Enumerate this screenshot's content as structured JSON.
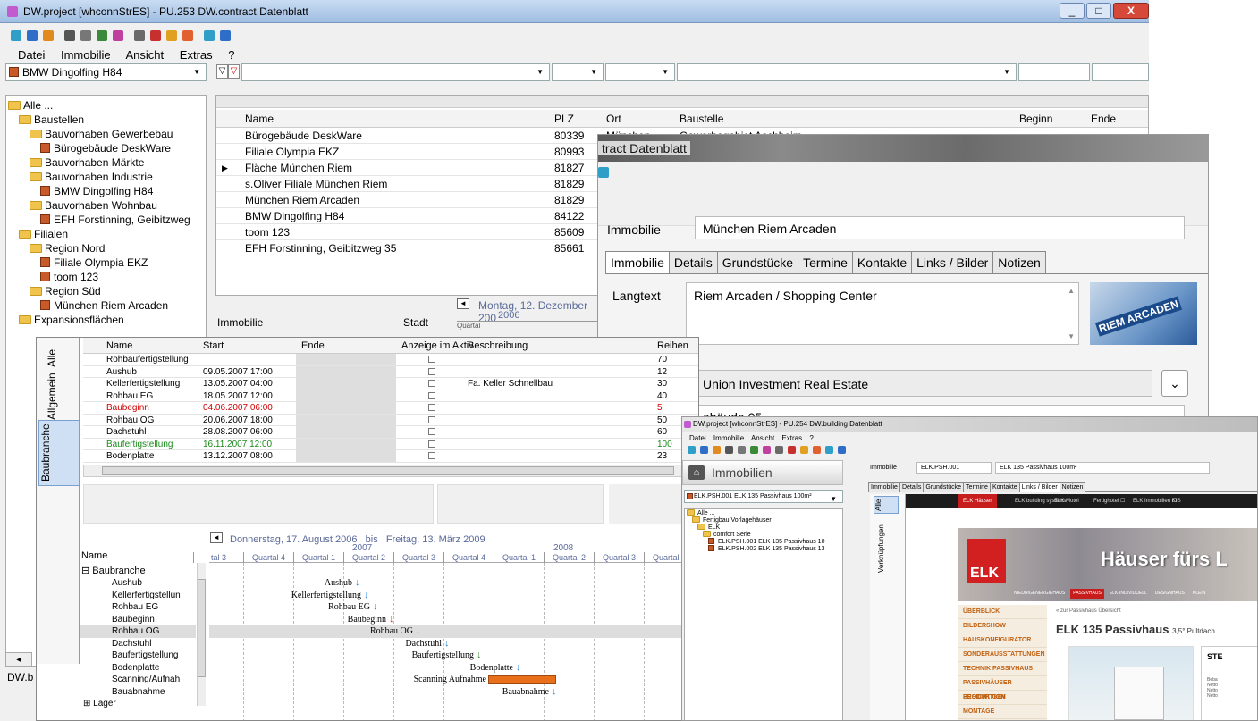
{
  "main": {
    "title": "DW.project [whconnStrES] - PU.253 DW.contract Datenblatt",
    "menu": [
      "Datei",
      "Immobilie",
      "Ansicht",
      "Extras",
      "?"
    ],
    "filter_combo": "BMW Dingolfing H84",
    "tree": [
      {
        "label": "Alle ...",
        "indent": 0,
        "folder": true
      },
      {
        "label": "Baustellen",
        "indent": 1,
        "folder": true
      },
      {
        "label": "Bauvorhaben Gewerbebau",
        "indent": 2,
        "folder": true
      },
      {
        "label": "Bürogebäude DeskWare",
        "indent": 3,
        "folder": false
      },
      {
        "label": "Bauvorhaben Märkte",
        "indent": 2,
        "folder": true
      },
      {
        "label": "Bauvorhaben Industrie",
        "indent": 2,
        "folder": true
      },
      {
        "label": "BMW Dingolfing H84",
        "indent": 3,
        "folder": false
      },
      {
        "label": "Bauvorhaben Wohnbau",
        "indent": 2,
        "folder": true
      },
      {
        "label": "EFH Forstinning, Geibitzweg",
        "indent": 3,
        "folder": false
      },
      {
        "label": "Filialen",
        "indent": 1,
        "folder": true
      },
      {
        "label": "Region Nord",
        "indent": 2,
        "folder": true
      },
      {
        "label": "Filiale Olympia EKZ",
        "indent": 3,
        "folder": false
      },
      {
        "label": "toom 123",
        "indent": 3,
        "folder": false
      },
      {
        "label": "Region Süd",
        "indent": 2,
        "folder": true
      },
      {
        "label": "München Riem Arcaden",
        "indent": 3,
        "folder": false
      },
      {
        "label": "Expansionsflächen",
        "indent": 1,
        "folder": true
      }
    ],
    "grid": {
      "headers": [
        "Name",
        "PLZ",
        "Ort",
        "Baustelle",
        "Beginn",
        "Ende"
      ],
      "rows": [
        [
          "Bürogebäude DeskWare",
          "80339",
          "München",
          "Gewerbegebiet Aschheim"
        ],
        [
          "Filiale Olympia EKZ",
          "80993"
        ],
        [
          "Fläche München Riem",
          "81827"
        ],
        [
          "s.Oliver Filiale München Riem",
          "81829"
        ],
        [
          "München Riem Arcaden",
          "81829"
        ],
        [
          "BMW Dingolfing H84",
          "84122"
        ],
        [
          "toom 123",
          "85609"
        ],
        [
          "EFH Forstinning, Geibitzweg 35",
          "85661"
        ]
      ]
    },
    "lower_labels": {
      "immobilie": "Immobilie",
      "stadt": "Stadt",
      "date": "Montag, 12. Dezember 200",
      "year": "2006",
      "quartal": "Quartal"
    },
    "status": "DW.b"
  },
  "contract": {
    "title": "tract Datenblatt",
    "immobilie_label": "Immobilie",
    "immobilie_value": "München Riem Arcaden",
    "tabs": [
      "Immobilie",
      "Details",
      "Grundstücke",
      "Termine",
      "Kontakte",
      "Links / Bilder",
      "Notizen"
    ],
    "langtext_label": "Langtext",
    "langtext_value": "Riem Arcaden / Shopping Center",
    "owner": "Union Investment Real Estate",
    "gebaeude": "ebäude 05",
    "logo_text": "RIEM ARCADEN"
  },
  "tasks": {
    "vtabs": [
      "Alle",
      "Allgemein",
      "Baubranche"
    ],
    "headers": [
      "Name",
      "Start",
      "Ende",
      "Anzeige im Aktiv",
      "Beschreibung",
      "Reihen"
    ],
    "rows": [
      {
        "name": "Rohbaufertigstellung",
        "start": "",
        "desc": "",
        "reihe": "70",
        "color": "#000"
      },
      {
        "name": "Aushub",
        "start": "09.05.2007 17:00",
        "desc": "",
        "reihe": "12",
        "color": "#000"
      },
      {
        "name": "Kellerfertigstellung",
        "start": "13.05.2007 04:00",
        "desc": "Fa. Keller Schnellbau",
        "reihe": "30",
        "color": "#000"
      },
      {
        "name": "Rohbau EG",
        "start": "18.05.2007 12:00",
        "desc": "",
        "reihe": "40",
        "color": "#000"
      },
      {
        "name": "Baubeginn",
        "start": "04.06.2007 06:00",
        "desc": "",
        "reihe": "5",
        "color": "#d00000"
      },
      {
        "name": "Rohbau OG",
        "start": "20.06.2007 18:00",
        "desc": "",
        "reihe": "50",
        "color": "#000"
      },
      {
        "name": "Dachstuhl",
        "start": "28.08.2007 06:00",
        "desc": "",
        "reihe": "60",
        "color": "#000"
      },
      {
        "name": "Baufertigstellung",
        "start": "16.11.2007 12:00",
        "desc": "",
        "reihe": "100",
        "color": "#1a8a1a"
      },
      {
        "name": "Bodenplatte",
        "start": "13.12.2007 08:00",
        "desc": "",
        "reihe": "23",
        "color": "#000"
      }
    ],
    "gantt_range": "Donnerstag, 17. August 2006   bis   Freitag, 13. März 2009",
    "gantt_years": [
      "2007",
      "2008"
    ],
    "gantt_quarters": [
      "tal 3",
      "Quartal 4",
      "Quartal 1",
      "Quartal 2",
      "Quartal 3",
      "Quartal 4",
      "Quartal 1",
      "Quartal 2",
      "Quartal 3",
      "Quartal 4"
    ],
    "gantt_name_header": "Name",
    "gantt_group": "Baubranche",
    "gantt_names": [
      "Aushub",
      "Kellerfertigstellun",
      "Rohbau EG",
      "Baubeginn",
      "Rohbau OG",
      "Dachstuhl",
      "Baufertigstellung",
      "Bodenplatte",
      "Scanning/Aufnah",
      "Bauabnahme",
      "Lager"
    ],
    "gantt_marks": [
      "Aushub",
      "Kellerfertigstellung",
      "Rohbau EG",
      "Baubeginn",
      "Rohbau OG",
      "Dachstuhl",
      "Baufertigstellung",
      "Bodenplatte",
      "Scanning Aufnahme",
      "Bauabnahme"
    ]
  },
  "building": {
    "title": "DW.project [whconnStrES] - PU.254 DW.building Datenblatt",
    "menu": [
      "Datei",
      "Immobilie",
      "Ansicht",
      "Extras",
      "?"
    ],
    "header": "Immobilien",
    "combo": "ELK.PSH.001 ELK 135 Passivhaus 100m²",
    "tree": [
      {
        "label": "Alle ...",
        "indent": 0,
        "folder": true
      },
      {
        "label": "Fertigbau Vorlagehäuser",
        "indent": 1,
        "folder": true
      },
      {
        "label": "ELK",
        "indent": 2,
        "folder": true
      },
      {
        "label": "comfort Serie",
        "indent": 3,
        "folder": true
      },
      {
        "label": "ELK.PSH.001 ELK 135 Passivhaus 10",
        "indent": 4,
        "folder": false
      },
      {
        "label": "ELK.PSH.002 ELK 135 Passivhaus 13",
        "indent": 4,
        "folder": false
      }
    ],
    "immobilie_label": "Immobilie",
    "code": "ELK.PSH.001",
    "name": "ELK 135 Passivhaus 100m²",
    "tabs": [
      "Immobilie",
      "Details",
      "Grundstücke",
      "Termine",
      "Kontakte",
      "Links / Bilder",
      "Notizen"
    ],
    "vtabs": [
      "Alle",
      "Verknüpfungen"
    ],
    "web_nav": [
      "ELK Häuser",
      "ELK building systems",
      "ELK Motel",
      "Fertighotel ☐",
      "ELK Immobilien ☐",
      "KIS"
    ],
    "banner": "Häuser fürs L",
    "elk": "ELK",
    "banner_nav": [
      "NIEDRIGENERGIEHAUS",
      "PASSIVHAUS",
      "ELK-INDIVIDUELL",
      "DESIGNHAUS",
      "KLEIN"
    ],
    "side_menu": [
      "ÜBERBLICK",
      "BILDERSHOW",
      "HAUSKONFIGURATOR",
      "SONDERAUSSTATTUNGEN",
      "TECHNIK PASSIVHAUS",
      "PASSIVHÄUSER BESICHTIGEN",
      "PRODUKTION",
      "MONTAGE"
    ],
    "back_link": "« zur Passivhaus Übersicht",
    "heading": "ELK 135 Passivhaus",
    "heading_sub": "3,5° Pultdach",
    "box_title": "STE",
    "box_lines": [
      "Beba",
      "Netto",
      "Netto",
      "Netto"
    ]
  }
}
